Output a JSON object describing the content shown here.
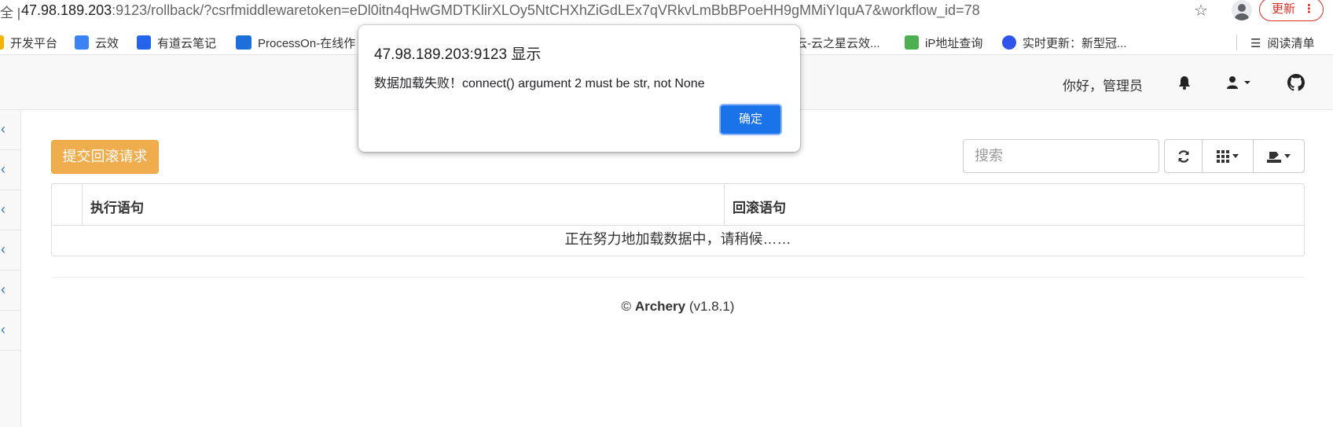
{
  "browser": {
    "left_fragment": "全 |",
    "url_host": "47.98.189.203",
    "url_rest": ":9123/rollback/?csrfmiddlewaretoken=eDl0itn4qHwGMDTKlirXLOy5NtCHXhZiGdLEx7qVRkvLmBbBPoeHH9gMMiYIquA7&workflow_id=78",
    "update_label": "更新",
    "update_dots": "⋮"
  },
  "bookmarks": [
    {
      "label": "开发平台",
      "icon": "folder-icon",
      "color": "#f4b400"
    },
    {
      "label": "云效",
      "icon": "yunxiao-icon",
      "color": "#3b82f6"
    },
    {
      "label": "有道云笔记",
      "icon": "youdao-note-icon",
      "color": "#2563eb"
    },
    {
      "label": "ProcessOn-在线作",
      "icon": "processon-icon",
      "color": "#1e6fd9"
    },
    {
      "label": "云-云之星云效...",
      "icon": "yunzhixing-icon",
      "color": "#ffffff"
    },
    {
      "label": "iP地址查询",
      "icon": "ip-query-icon",
      "color": "#4caf50"
    },
    {
      "label": "实时更新：新型冠...",
      "icon": "baidu-paw-icon",
      "color": "#2f54eb"
    }
  ],
  "reading_list_label": "阅读清单",
  "navbar": {
    "greeting": "你好，管理员"
  },
  "toolbar": {
    "submit_label": "提交回滚请求",
    "search_placeholder": "搜索"
  },
  "table": {
    "columns": [
      "执行语句",
      "回滚语句"
    ],
    "loading_text": "正在努力地加载数据中，请稍候……"
  },
  "footer": {
    "copyright": "©",
    "brand": "Archery",
    "version": "(v1.8.1)"
  },
  "dialog": {
    "title": "47.98.189.203:9123 显示",
    "message": "数据加载失败！connect() argument 2 must be str, not None",
    "ok_label": "确定"
  },
  "colors": {
    "warning_button": "#f0ad4e",
    "primary_blue": "#1a73e8",
    "link_blue": "#337ab7"
  }
}
